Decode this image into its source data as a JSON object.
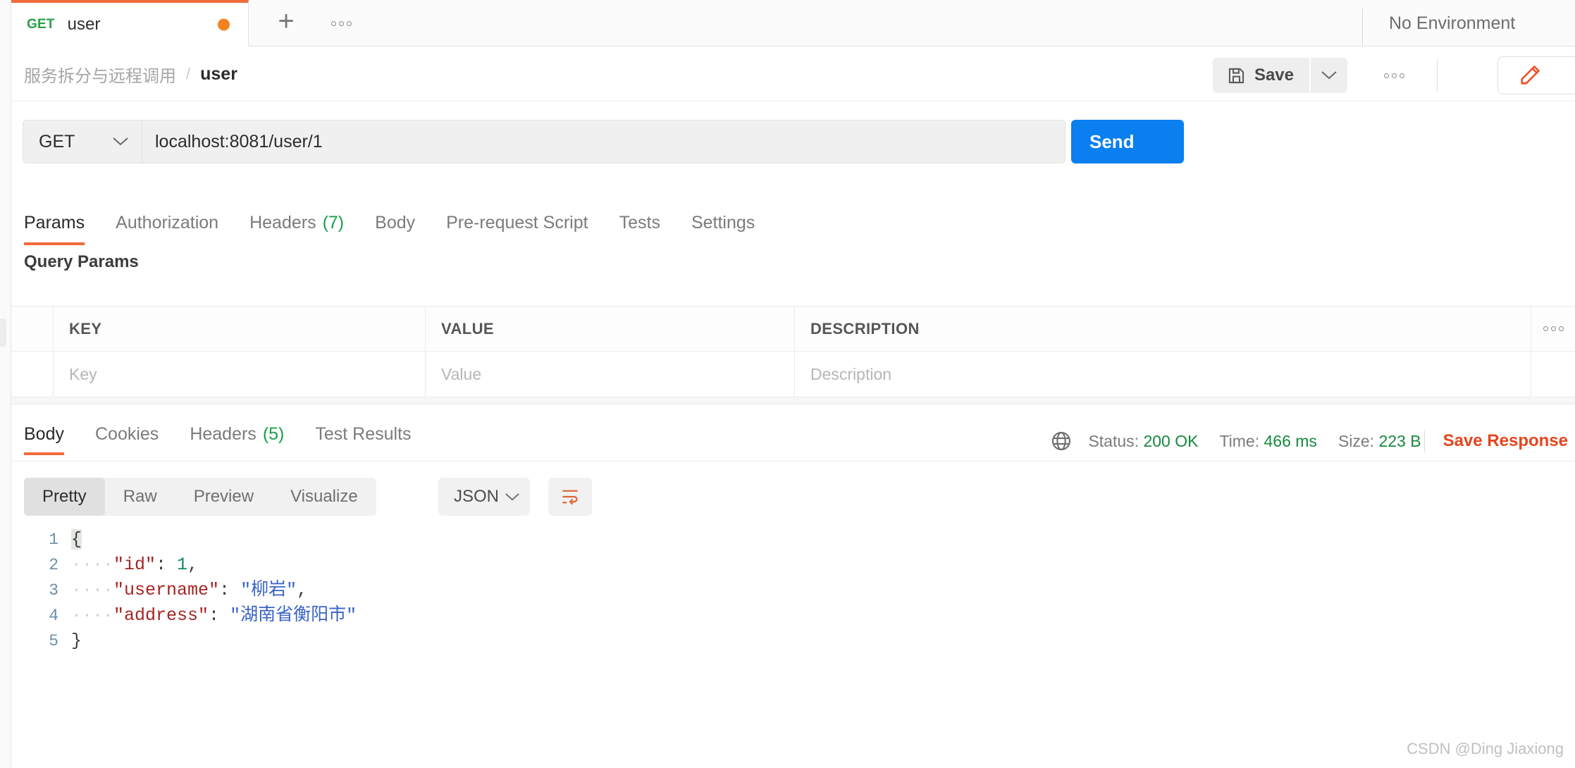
{
  "tabstrip": {
    "tab": {
      "method": "GET",
      "name": "user",
      "unsaved_icon": "orange-dot"
    },
    "new_tab_icon": "plus-icon",
    "more_icon": "ellipsis-icon",
    "environment": "No Environment"
  },
  "header": {
    "breadcrumb": {
      "collection": "服务拆分与远程调用",
      "separator": "/",
      "current": "user"
    },
    "save_label": "Save",
    "save_icon": "floppy-disk-icon",
    "save_caret_icon": "chevron-down-icon",
    "more_icon": "ellipsis-icon",
    "edit_icon": "pencil-icon"
  },
  "request": {
    "method": "GET",
    "method_caret_icon": "chevron-down-icon",
    "url": "localhost:8081/user/1",
    "send_label": "Send",
    "send_color": "#0a7ff0",
    "tabs": [
      {
        "label": "Params",
        "active": true
      },
      {
        "label": "Authorization",
        "active": false
      },
      {
        "label": "Headers",
        "count": "(7)",
        "active": false
      },
      {
        "label": "Body",
        "active": false
      },
      {
        "label": "Pre-request Script",
        "active": false
      },
      {
        "label": "Tests",
        "active": false
      },
      {
        "label": "Settings",
        "active": false
      }
    ],
    "query_params_title": "Query Params",
    "table": {
      "headers": [
        "KEY",
        "VALUE",
        "DESCRIPTION"
      ],
      "bulk_edit_icon": "ellipsis-icon",
      "placeholder_row": {
        "key": "Key",
        "value": "Value",
        "description": "Description"
      }
    }
  },
  "response": {
    "tabs": [
      {
        "label": "Body",
        "active": true
      },
      {
        "label": "Cookies",
        "active": false
      },
      {
        "label": "Headers",
        "count": "(5)",
        "active": false
      },
      {
        "label": "Test Results",
        "active": false
      }
    ],
    "globe_icon": "globe-icon",
    "status_label": "Status:",
    "status_value": "200 OK",
    "time_label": "Time:",
    "time_value": "466 ms",
    "size_label": "Size:",
    "size_value": "223 B",
    "save_response_label": "Save Response",
    "save_response_color": "#e5451e",
    "status_color": "#17883f",
    "view_modes": [
      {
        "label": "Pretty",
        "active": true
      },
      {
        "label": "Raw",
        "active": false
      },
      {
        "label": "Preview",
        "active": false
      },
      {
        "label": "Visualize",
        "active": false
      }
    ],
    "format": "JSON",
    "format_caret_icon": "chevron-down-icon",
    "wrap_icon": "word-wrap-icon",
    "body_lines": [
      {
        "no": "1",
        "segments": [
          {
            "t": "{",
            "c": "brace-hl"
          }
        ]
      },
      {
        "no": "2",
        "segments": [
          {
            "t": "····",
            "c": "indent"
          },
          {
            "t": "\"id\"",
            "c": "tok-key"
          },
          {
            "t": ": ",
            "c": "tok-punc"
          },
          {
            "t": "1",
            "c": "tok-num"
          },
          {
            "t": ",",
            "c": "tok-punc"
          }
        ]
      },
      {
        "no": "3",
        "segments": [
          {
            "t": "····",
            "c": "indent"
          },
          {
            "t": "\"username\"",
            "c": "tok-key"
          },
          {
            "t": ": ",
            "c": "tok-punc"
          },
          {
            "t": "\"柳岩\"",
            "c": "tok-str"
          },
          {
            "t": ",",
            "c": "tok-punc"
          }
        ]
      },
      {
        "no": "4",
        "segments": [
          {
            "t": "····",
            "c": "indent"
          },
          {
            "t": "\"address\"",
            "c": "tok-key"
          },
          {
            "t": ": ",
            "c": "tok-punc"
          },
          {
            "t": "\"湖南省衡阳市\"",
            "c": "tok-str"
          }
        ]
      },
      {
        "no": "5",
        "segments": [
          {
            "t": "}",
            "c": "tok-punc"
          }
        ]
      }
    ],
    "json_payload": {
      "id": 1,
      "username": "柳岩",
      "address": "湖南省衡阳市"
    }
  },
  "watermark": "CSDN @Ding Jiaxiong"
}
